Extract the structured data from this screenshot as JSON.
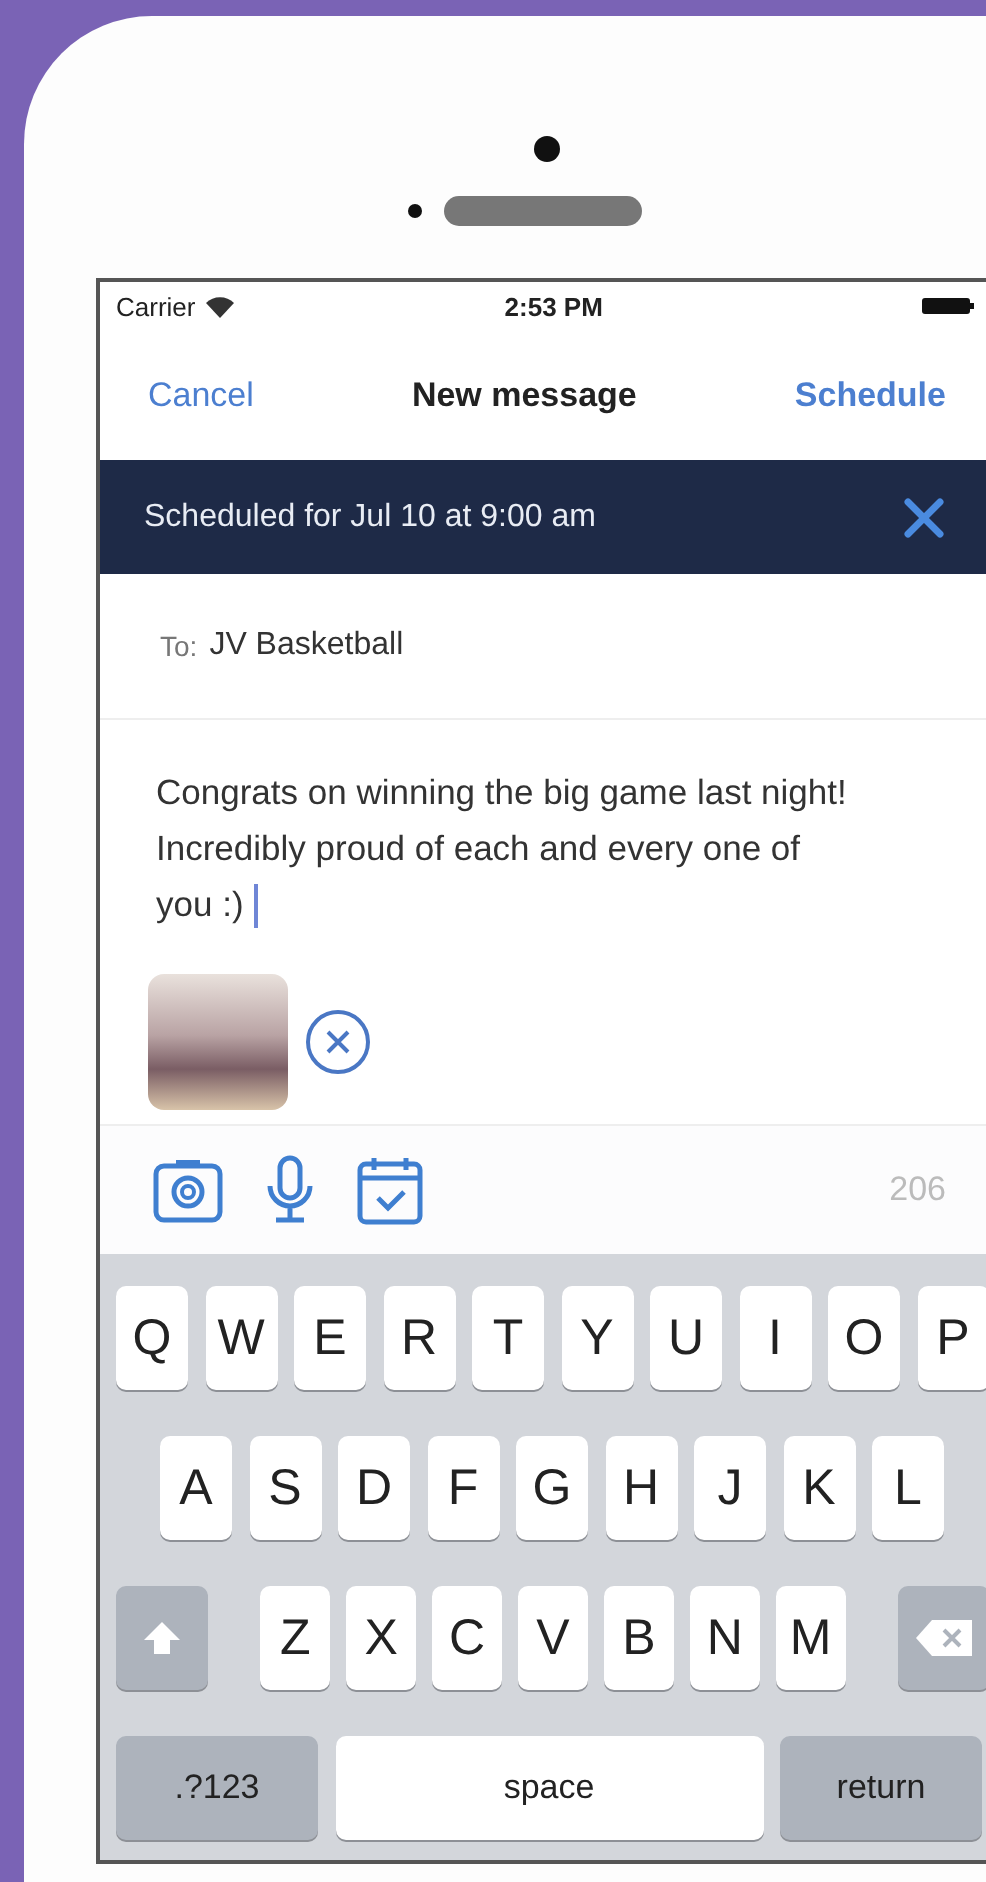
{
  "status_bar": {
    "carrier": "Carrier",
    "time": "2:53 PM"
  },
  "nav": {
    "cancel": "Cancel",
    "title": "New message",
    "action": "Schedule"
  },
  "banner": {
    "text": "Scheduled for Jul 10 at 9:00 am"
  },
  "recipient": {
    "label": "To:",
    "value": "JV Basketball"
  },
  "message": {
    "text": "Congrats on winning the big game last night! Incredibly proud of each and every one of you :)"
  },
  "toolbar": {
    "counter": "206"
  },
  "keyboard": {
    "rows": [
      [
        "Q",
        "W",
        "E",
        "R",
        "T",
        "Y",
        "U",
        "I",
        "O",
        "P"
      ],
      [
        "A",
        "S",
        "D",
        "F",
        "G",
        "H",
        "J",
        "K",
        "L"
      ],
      [
        "Z",
        "X",
        "C",
        "V",
        "B",
        "N",
        "M"
      ]
    ],
    "bottom": [
      {
        "label": ".?123",
        "kind": "function"
      },
      {
        "label": "space",
        "kind": "space"
      },
      {
        "label": "return",
        "kind": "function"
      }
    ]
  }
}
